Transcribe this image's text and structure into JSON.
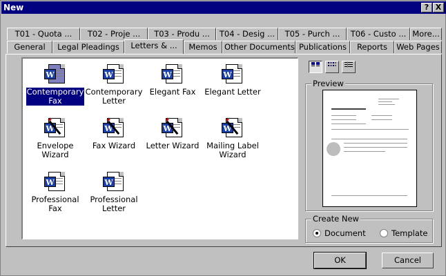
{
  "window": {
    "title": "New"
  },
  "titlebar_buttons": {
    "help": "?",
    "close": "X"
  },
  "tabs_top": [
    "T01 - Quota ...",
    "T02 - Proje ...",
    "T03 - Produ ...",
    "T04 - Desig ...",
    "T05 - Purch ...",
    "T06 - Custo ...",
    "More..."
  ],
  "tabs_bottom": [
    "General",
    "Legal Pleadings",
    "Letters & ...",
    "Memos",
    "Other Documents",
    "Publications",
    "Reports",
    "Web Pages"
  ],
  "active_tab": "Letters & ...",
  "templates": [
    {
      "line1": "Contemporary",
      "line2": "Fax",
      "icon": "word-document-icon",
      "selected": true
    },
    {
      "line1": "Contemporary",
      "line2": "Letter",
      "icon": "word-document-icon",
      "selected": false
    },
    {
      "line1": "Elegant Fax",
      "line2": "",
      "icon": "word-document-icon",
      "selected": false
    },
    {
      "line1": "Elegant Letter",
      "line2": "",
      "icon": "word-document-icon",
      "selected": false
    },
    {
      "line1": "Envelope",
      "line2": "Wizard",
      "icon": "word-wizard-icon",
      "selected": false
    },
    {
      "line1": "Fax Wizard",
      "line2": "",
      "icon": "word-wizard-icon",
      "selected": false
    },
    {
      "line1": "Letter Wizard",
      "line2": "",
      "icon": "word-wizard-icon",
      "selected": false
    },
    {
      "line1": "Mailing Label",
      "line2": "Wizard",
      "icon": "word-wizard-icon",
      "selected": false
    },
    {
      "line1": "Professional",
      "line2": "Fax",
      "icon": "word-document-icon",
      "selected": false
    },
    {
      "line1": "Professional",
      "line2": "Letter",
      "icon": "word-document-icon",
      "selected": false
    }
  ],
  "view_buttons": [
    "large-icons-icon",
    "list-icon",
    "details-icon"
  ],
  "preview": {
    "label": "Preview"
  },
  "create_new": {
    "label": "Create New",
    "options": [
      {
        "label": "Document",
        "checked": true
      },
      {
        "label": "Template",
        "checked": false
      }
    ]
  },
  "buttons": {
    "ok": "OK",
    "cancel": "Cancel"
  },
  "colors": {
    "titlebar": "#000080",
    "face": "#c0c0c0",
    "selection": "#000080"
  }
}
